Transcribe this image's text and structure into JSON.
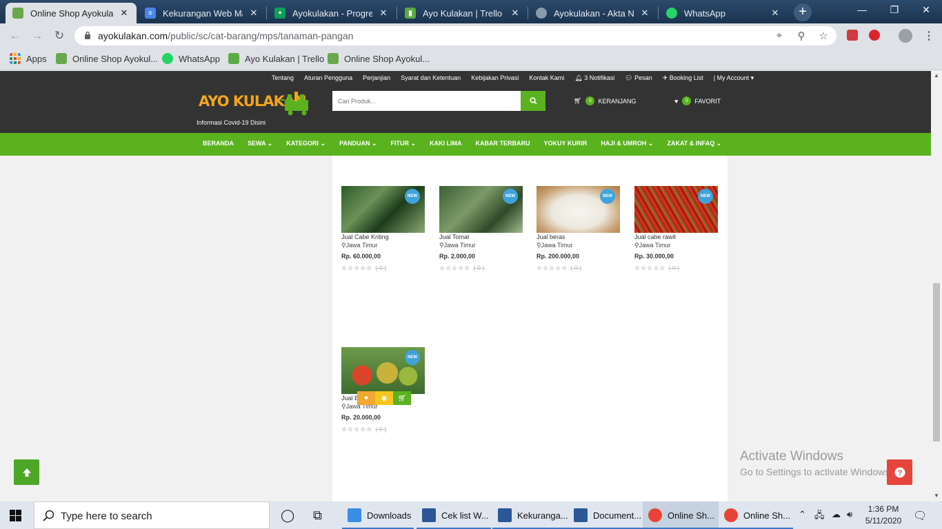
{
  "browser": {
    "tabs": [
      {
        "title": "Online Shop Ayokulakan",
        "icon": "ayokulakan-favicon",
        "active": true
      },
      {
        "title": "Kekurangan Web Market",
        "icon": "google-docs-icon"
      },
      {
        "title": "Ayokulakan - Progress",
        "icon": "google-sheets-icon"
      },
      {
        "title": "Ayo Kulakan | Trello",
        "icon": "trello-icon"
      },
      {
        "title": "Ayokulakan - Akta Notaris",
        "icon": "globe-icon"
      },
      {
        "title": "WhatsApp",
        "icon": "whatsapp-icon"
      }
    ],
    "url_domain": "ayokulakan.com",
    "url_path": "/public/sc/cat-barang/mps/tanaman-pangan",
    "bookmarks": [
      {
        "label": "Apps",
        "icon": "apps-grid-icon"
      },
      {
        "label": "Online Shop Ayokul...",
        "icon": "ayokulakan-favicon"
      },
      {
        "label": "WhatsApp",
        "icon": "whatsapp-icon"
      },
      {
        "label": "Ayo Kulakan | Trello",
        "icon": "trello-icon"
      },
      {
        "label": "Online Shop Ayokul...",
        "icon": "ayokulakan-favicon"
      }
    ]
  },
  "site": {
    "top_links": [
      "Tentang",
      "Aturan Pengguna",
      "Perjanjian",
      "Syarat dan Ketentuan",
      "Kebijakan Privasi",
      "Kontak Kami",
      "3 Notifikasi",
      "Pesan",
      "Booking List",
      "| My Account"
    ],
    "logo_text": "AYO KULAKAN",
    "covid_link": "Informasi Covid-19 Disini",
    "search_placeholder": "Cari Produk...",
    "cart": {
      "count": "0",
      "label": "KERANJANG"
    },
    "favorite": {
      "count": "0",
      "label": "FAVORIT"
    },
    "nav": [
      "BERANDA",
      "SEWA",
      "KATEGORI",
      "PANDUAN",
      "FITUR",
      "KAKI LIMA",
      "KABAR TERBARU",
      "YOKUY KURIR",
      "HAJI & UMROH",
      "ZAKAT & INFAQ"
    ],
    "nav_has_dropdown": [
      false,
      true,
      true,
      true,
      true,
      false,
      false,
      false,
      true,
      true
    ],
    "accent_color": "#5ab21f",
    "header_bg": "#333333"
  },
  "products": [
    {
      "name": "Jual Cabe Kriting",
      "location": "Jawa Timur",
      "price": "Rp. 60.000,00",
      "rating": "☆☆☆☆☆",
      "reviews": "( 0 )",
      "badge": "NEW"
    },
    {
      "name": "Jual Tomat",
      "location": "Jawa Timur",
      "price": "Rp. 2.000,00",
      "rating": "☆☆☆☆☆",
      "reviews": "( 0 )",
      "badge": "NEW"
    },
    {
      "name": "Jual beras",
      "location": "Jawa Timur",
      "price": "Rp. 200.000,00",
      "rating": "☆☆☆☆☆",
      "reviews": "( 0 )",
      "badge": "NEW"
    },
    {
      "name": "Jual cabe rawit",
      "location": "Jawa Timur",
      "price": "Rp. 30.000,00",
      "rating": "☆☆☆☆☆",
      "reviews": "( 0 )",
      "badge": "NEW"
    },
    {
      "name": "Jual B",
      "location": "Jawa Timur",
      "price": "Rp. 20.000,00",
      "rating": "☆☆☆☆☆",
      "reviews": "( 0 )",
      "badge": "NEW"
    }
  ],
  "watermark": {
    "line1": "Activate Windows",
    "line2": "Go to Settings to activate Windows."
  },
  "taskbar": {
    "search_text": "Type here to search",
    "apps": [
      {
        "label": "Downloads",
        "icon": "download-folder-icon"
      },
      {
        "label": "Cek list W...",
        "icon": "word-icon"
      },
      {
        "label": "Kekuranga...",
        "icon": "word-icon"
      },
      {
        "label": "Document...",
        "icon": "word-icon"
      },
      {
        "label": "Online Sh...",
        "icon": "chrome-icon",
        "active": true
      },
      {
        "label": "Online Sh...",
        "icon": "chrome-icon"
      }
    ],
    "time": "1:36 PM",
    "date": "5/11/2020"
  }
}
